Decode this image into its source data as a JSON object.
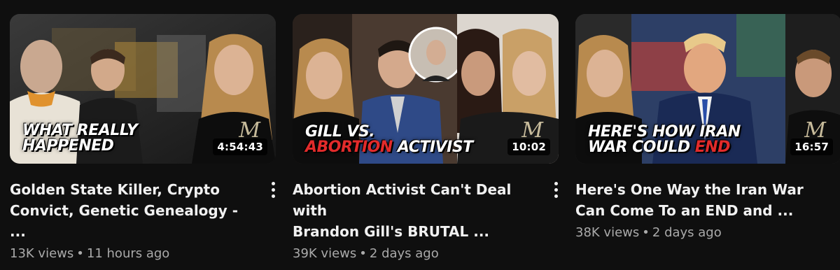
{
  "videos": [
    {
      "overlay": [
        "WHAT REALLY",
        "HAPPENED"
      ],
      "duration": "4:54:43",
      "title": "Golden State Killer, Crypto\nConvict, Genetic Genealogy - ...",
      "views": "13K views",
      "age": "11 hours ago"
    },
    {
      "overlay_parts": {
        "line1": "GILL VS.",
        "line2_red": "ABORTION",
        "line2_white": " ACTIVIST"
      },
      "duration": "10:02",
      "title": "Abortion Activist Can't Deal with\nBrandon Gill's BRUTAL ...",
      "views": "39K views",
      "age": "2 days ago"
    },
    {
      "overlay_parts": {
        "line1": "HERE'S HOW IRAN",
        "line2_white": "WAR COULD ",
        "line2_red": "END"
      },
      "duration": "16:57",
      "title": "Here's One Way the Iran War\nCan Come To an END and ...",
      "views": "38K views",
      "age": "2 days ago"
    }
  ],
  "separator": "•",
  "logo_glyph": "M",
  "colors": {
    "background": "#0f0f0f",
    "accent_red": "#e22b2b",
    "secondary_text": "#aaaaaa"
  }
}
